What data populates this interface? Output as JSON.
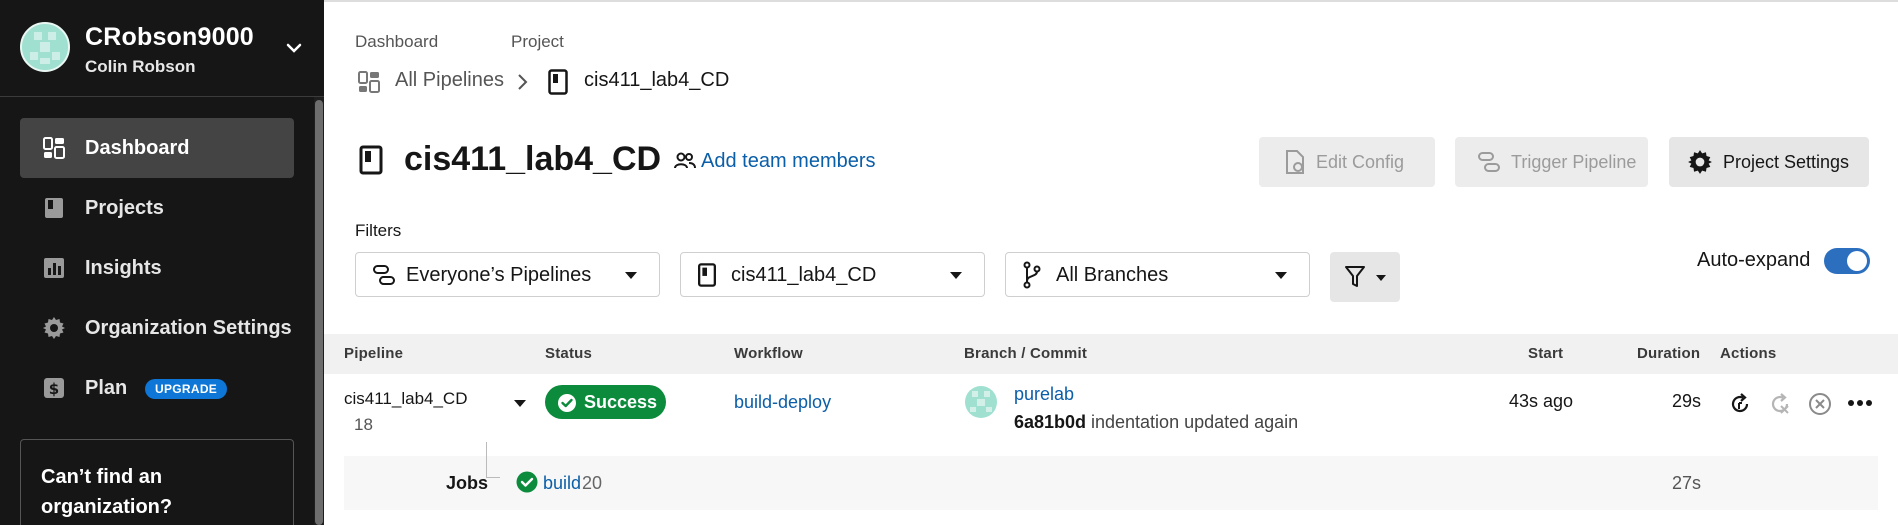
{
  "sidebar": {
    "org_name": "CRobson9000",
    "user_name": "Colin Robson",
    "items": [
      {
        "label": "Dashboard",
        "icon": "dashboard-icon",
        "active": true
      },
      {
        "label": "Projects",
        "icon": "project-icon",
        "active": false
      },
      {
        "label": "Insights",
        "icon": "insights-icon",
        "active": false
      },
      {
        "label": "Organization Settings",
        "icon": "gear-icon",
        "active": false
      },
      {
        "label": "Plan",
        "icon": "plan-icon",
        "active": false,
        "badge": "UPGRADE"
      }
    ],
    "cant_find": "Can’t find an organization?"
  },
  "breadcrumb": {
    "dashboard_label": "Dashboard",
    "project_label": "Project",
    "all_pipelines": "All Pipelines",
    "project_name": "cis411_lab4_CD"
  },
  "header": {
    "title": "cis411_lab4_CD",
    "add_team": "Add team members",
    "edit_config": "Edit Config",
    "trigger_pipeline": "Trigger Pipeline",
    "project_settings": "Project Settings"
  },
  "filters": {
    "label": "Filters",
    "pipelines": "Everyone’s Pipelines",
    "project": "cis411_lab4_CD",
    "branches": "All Branches",
    "auto_expand": "Auto-expand",
    "auto_expand_on": true
  },
  "table": {
    "headers": {
      "pipeline": "Pipeline",
      "status": "Status",
      "workflow": "Workflow",
      "branch_commit": "Branch / Commit",
      "start": "Start",
      "duration": "Duration",
      "actions": "Actions"
    },
    "rows": [
      {
        "pipeline": "cis411_lab4_CD",
        "number": "18",
        "status": "Success",
        "workflow": "build-deploy",
        "branch": "purelab",
        "commit_hash": "6a81b0d",
        "commit_message": "indentation updated again",
        "start": "43s ago",
        "duration": "29s",
        "jobs_label": "Jobs",
        "job_name": "build",
        "job_number": "20",
        "job_duration": "27s"
      }
    ]
  },
  "colors": {
    "sidebar_bg": "#161616",
    "success_green": "#0c8b3c",
    "link_blue": "#0b5ea8",
    "toggle_blue": "#2c6fbf",
    "upgrade_badge": "#0d76d6"
  }
}
